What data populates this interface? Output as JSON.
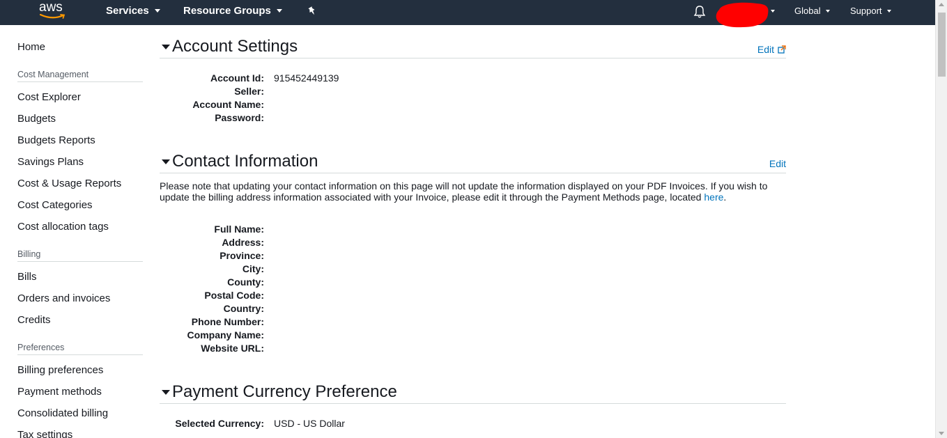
{
  "nav": {
    "logo_text": "aws",
    "services": "Services",
    "resource_groups": "Resource Groups",
    "pin_icon": "pin-icon",
    "bell_icon": "bell-icon",
    "account_redacted_color": "#ff0000",
    "global": "Global",
    "support": "Support"
  },
  "sidebar": {
    "home": "Home",
    "sections": [
      {
        "title": "Cost Management",
        "items": [
          "Cost Explorer",
          "Budgets",
          "Budgets Reports",
          "Savings Plans",
          "Cost & Usage Reports",
          "Cost Categories",
          "Cost allocation tags"
        ]
      },
      {
        "title": "Billing",
        "items": [
          "Bills",
          "Orders and invoices",
          "Credits"
        ]
      },
      {
        "title": "Preferences",
        "items": [
          "Billing preferences",
          "Payment methods",
          "Consolidated billing",
          "Tax settings"
        ]
      }
    ]
  },
  "account_settings": {
    "title": "Account Settings",
    "edit": "Edit",
    "fields": [
      {
        "label": "Account Id:",
        "value": "915452449139"
      },
      {
        "label": "Seller:",
        "value": ""
      },
      {
        "label": "Account Name:",
        "value": ""
      },
      {
        "label": "Password:",
        "value": ""
      }
    ]
  },
  "contact_information": {
    "title": "Contact Information",
    "edit": "Edit",
    "notice": "Please note that updating your contact information on this page will not update the information displayed on your PDF Invoices. If you wish to update the billing address information associated with your Invoice, please edit it through the Payment Methods page, located ",
    "notice_link": "here",
    "notice_end": ".",
    "fields": [
      {
        "label": "Full Name:",
        "value": ""
      },
      {
        "label": "Address:",
        "value": ""
      },
      {
        "label": "Province:",
        "value": ""
      },
      {
        "label": "City:",
        "value": ""
      },
      {
        "label": "County:",
        "value": ""
      },
      {
        "label": "Postal Code:",
        "value": ""
      },
      {
        "label": "Country:",
        "value": ""
      },
      {
        "label": "Phone Number:",
        "value": ""
      },
      {
        "label": "Company Name:",
        "value": ""
      },
      {
        "label": "Website URL:",
        "value": ""
      }
    ]
  },
  "payment_currency": {
    "title": "Payment Currency Preference",
    "fields": [
      {
        "label": "Selected Currency:",
        "value": "USD - US Dollar"
      }
    ]
  },
  "colors": {
    "nav_bg": "#232f3e",
    "link": "#0073bb",
    "divider": "#d5dbdb"
  }
}
